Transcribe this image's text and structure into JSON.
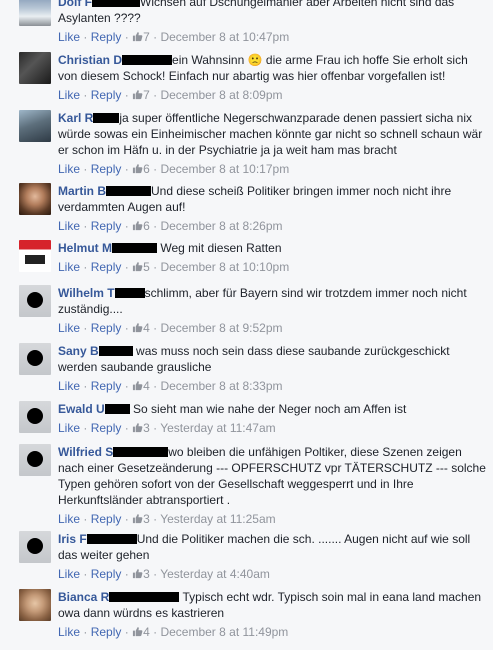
{
  "actions": {
    "like": "Like",
    "reply": "Reply",
    "sep": "·"
  },
  "comments": [
    {
      "author": "Dolf F",
      "text": "Wichsen auf Dschungelmanier aber Arbeiten nicht sind das Asylanten ????",
      "likes": "7",
      "time": "December 8 at 10:47pm"
    },
    {
      "author": "Christian D",
      "text": "ein Wahnsinn 🙁 die arme Frau ich hoffe Sie erholt sich von diesem Schock! Einfach nur abartig was hier offenbar vorgefallen ist!",
      "likes": "7",
      "time": "December 8 at 8:09pm"
    },
    {
      "author": "Karl R",
      "text": "ja super öffentliche Negerschwanzparade denen passiert sicha nix würde sowas ein Einheimischer machen könnte gar nicht so schnell schaun wär er schon im Häfn u. in der Psychiatrie ja ja weit ham mas bracht",
      "likes": "6",
      "time": "December 8 at 10:17pm"
    },
    {
      "author": "Martin B",
      "text": "Und diese scheiß Politiker bringen immer noch nicht ihre verdammten Augen auf!",
      "likes": "6",
      "time": "December 8 at 8:26pm"
    },
    {
      "author": "Helmut M",
      "text": " Weg mit diesen Ratten",
      "likes": "5",
      "time": "December 8 at 10:10pm"
    },
    {
      "author": "Wilhelm T",
      "text": "schlimm, aber für Bayern sind wir trotzdem immer noch nicht zuständig....",
      "likes": "4",
      "time": "December 8 at 9:52pm"
    },
    {
      "author": "Sany B",
      "text": " was muss noch sein dass diese saubande zurückgeschickt werden saubande grausliche",
      "likes": "4",
      "time": "December 8 at 8:33pm"
    },
    {
      "author": "Ewald U",
      "text": " So sieht man wie nahe der Neger noch am Affen ist",
      "likes": "3",
      "time": "Yesterday at 11:47am"
    },
    {
      "author": "Wilfried S",
      "text": "wo bleiben die unfähigen Poltiker, diese Szenen zeigen nach einer Gesetzeänderung --- OPFERSCHUTZ vpr TÄTERSCHUTZ --- solche Typen gehören sofort von der Gesellschaft weggesperrt und in Ihre Herkunftsländer abtransportiert .",
      "likes": "3",
      "time": "Yesterday at 11:25am"
    },
    {
      "author": "Iris F",
      "text": "Und die Politiker machen die sch. ....... Augen nicht auf wie soll das weiter gehen",
      "likes": "3",
      "time": "Yesterday at 4:40am"
    },
    {
      "author": "Bianca R",
      "text": " Typisch echt wdr. Typisch soin mal in eana land machen owa dann würdns es kastrieren",
      "likes": "4",
      "time": "December 8 at 11:49pm"
    }
  ]
}
